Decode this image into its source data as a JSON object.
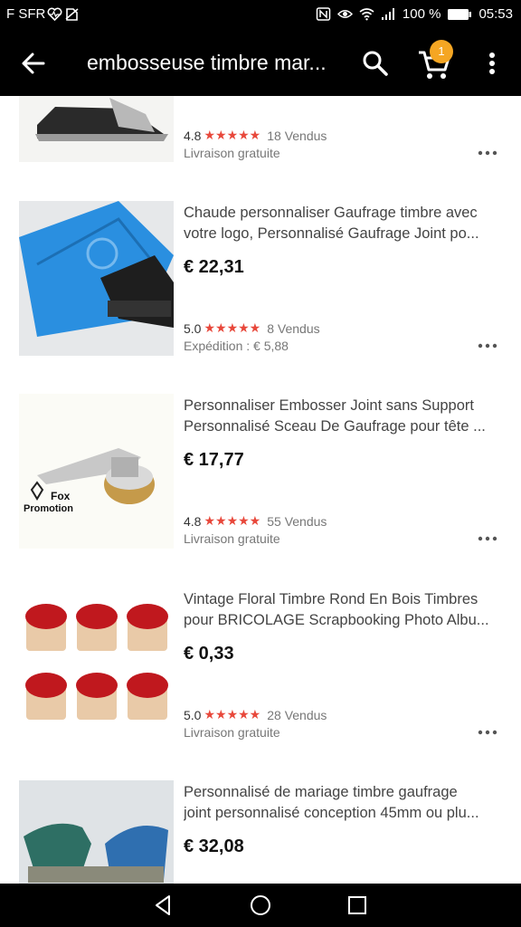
{
  "status_bar": {
    "carrier": "F SFR",
    "battery": "100 %",
    "time": "05:53"
  },
  "app_bar": {
    "title": "embosseuse timbre mar...",
    "cart_count": "1"
  },
  "products": [
    {
      "title_line1": "",
      "title_line2": "",
      "price": "",
      "rating": "4.8",
      "sold": "18 Vendus",
      "shipping": "Livraison gratuite"
    },
    {
      "title_line1": "Chaude personnaliser Gaufrage timbre avec",
      "title_line2": "votre logo, Personnalisé Gaufrage Joint po...",
      "price": "€ 22,31",
      "rating": "5.0",
      "sold": "8 Vendus",
      "shipping": "Expédition : € 5,88"
    },
    {
      "title_line1": "Personnaliser Embosser Joint sans Support",
      "title_line2": "Personnalisé Sceau De Gaufrage pour tête ...",
      "price": "€ 17,77",
      "rating": "4.8",
      "sold": "55 Vendus",
      "shipping": "Livraison gratuite",
      "image_text_1": "Fox",
      "image_text_2": "Promotion"
    },
    {
      "title_line1": "Vintage Floral Timbre Rond En Bois Timbres",
      "title_line2": "pour BRICOLAGE Scrapbooking Photo Albu...",
      "price": "€ 0,33",
      "rating": "5.0",
      "sold": "28 Vendus",
      "shipping": "Livraison gratuite"
    },
    {
      "title_line1": "Personnalisé de mariage timbre gaufrage",
      "title_line2": "joint personnalisé conception 45mm ou plu...",
      "price": "€ 32,08"
    }
  ],
  "stars_glyph": "★★★★★",
  "colors": {
    "bar_bg": "#000000",
    "star": "#e8483b",
    "badge": "#f5a623"
  }
}
